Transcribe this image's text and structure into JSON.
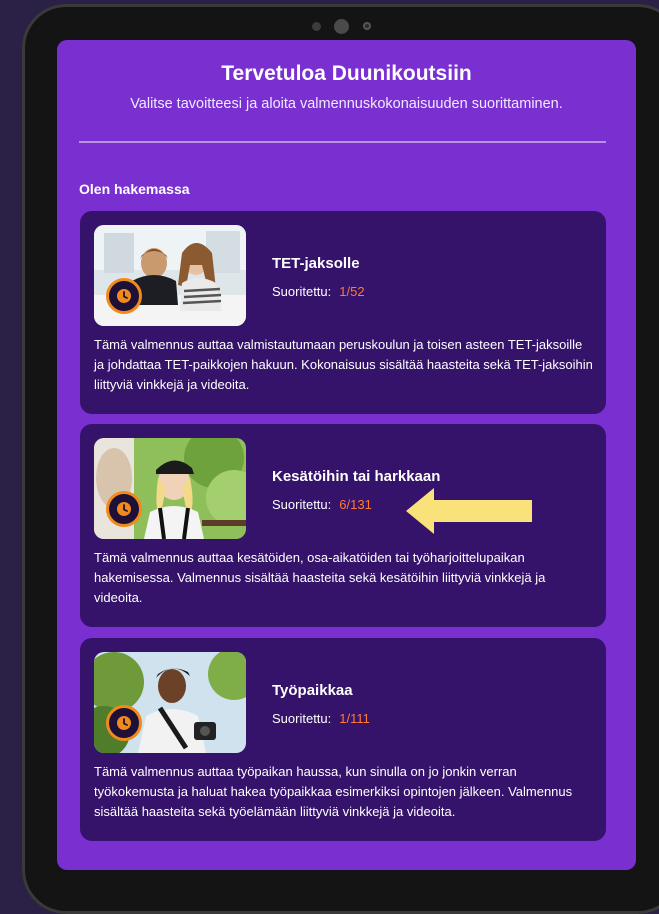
{
  "header": {
    "title": "Tervetuloa Duunikoutsiin",
    "subtitle": "Valitse tavoitteesi ja aloita valmennuskokonaisuuden suorittaminen."
  },
  "section": {
    "label": "Olen hakemassa"
  },
  "cards": [
    {
      "title": "TET-jaksolle",
      "progress_label": "Suoritettu:",
      "progress_value": "1/52",
      "description": "Tämä valmennus auttaa valmistautumaan peruskoulun ja toisen asteen TET-jaksoille ja johdattaa TET-paikkojen hakuun. Kokonaisuus sisältää haasteita sekä TET-jaksoihin liittyviä vinkkejä ja videoita."
    },
    {
      "title": "Kesätöihin tai harkkaan",
      "progress_label": "Suoritettu:",
      "progress_value": "6/131",
      "description": "Tämä valmennus auttaa kesätöiden, osa-aikatöiden tai työharjoittelupaikan hakemisessa. Valmennus sisältää haasteita sekä kesätöihin liittyviä vinkkejä ja videoita."
    },
    {
      "title": "Työpaikkaa",
      "progress_label": "Suoritettu:",
      "progress_value": "1/111",
      "description": "Tämä valmennus auttaa työpaikan haussa, kun sinulla on jo jonkin verran työkokemusta ja haluat hakea työpaikkaa esimerkiksi opintojen jälkeen. Valmennus sisältää haasteita sekä työelämään liittyviä vinkkejä ja videoita."
    }
  ],
  "colors": {
    "screen": "#7a2fd1",
    "card": "#35136a",
    "accent_progress": "#ff7a35",
    "badge_ring": "#f08a1c",
    "highlight_arrow": "#f9e27a"
  },
  "icons": [
    "clock-icon",
    "highlight-arrow"
  ]
}
